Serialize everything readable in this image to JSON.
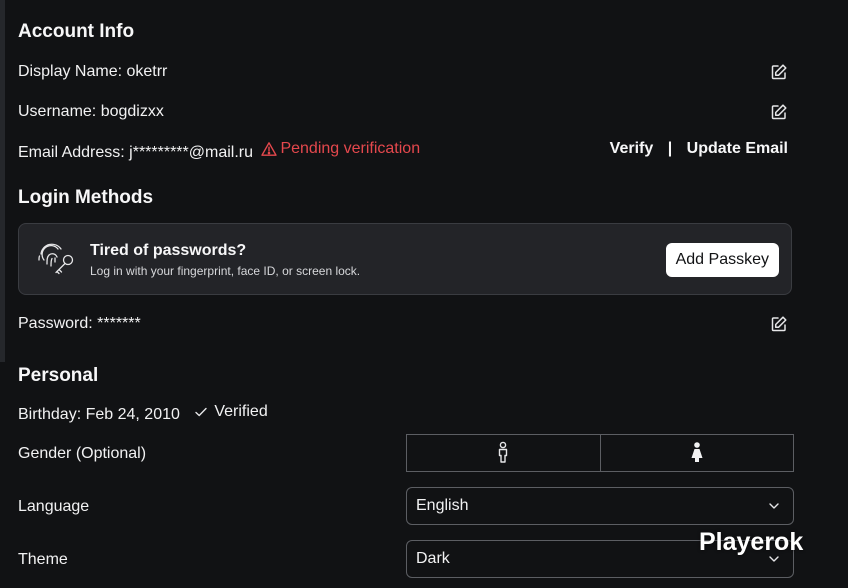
{
  "account_info": {
    "title": "Account Info",
    "display_name": "Display Name: oketrr",
    "username": "Username: bogdizxx",
    "email": "Email Address: j*********@mail.ru",
    "email_status": "Pending verification",
    "verify_label": "Verify",
    "separator": "|",
    "update_email_label": "Update Email"
  },
  "login_methods": {
    "title": "Login Methods",
    "passkey_title": "Tired of passwords?",
    "passkey_subtitle": "Log in with your fingerprint, face ID, or screen lock.",
    "add_passkey_label": "Add Passkey",
    "password": "Password: *******"
  },
  "personal": {
    "title": "Personal",
    "birthday": "Birthday: Feb 24, 2010",
    "birthday_status": "Verified",
    "gender_label": "Gender (Optional)",
    "language_label": "Language",
    "language_value": "English",
    "theme_label": "Theme",
    "theme_value": "Dark"
  },
  "watermark": "Playerok",
  "colors": {
    "background": "#111214",
    "card": "#232428",
    "warning": "#e5484d",
    "text": "#f7f7f8"
  },
  "icons": [
    "edit-icon",
    "warning-icon",
    "fingerprint-key-icon",
    "checkmark-icon",
    "male-icon",
    "female-icon",
    "chevron-down-icon"
  ]
}
